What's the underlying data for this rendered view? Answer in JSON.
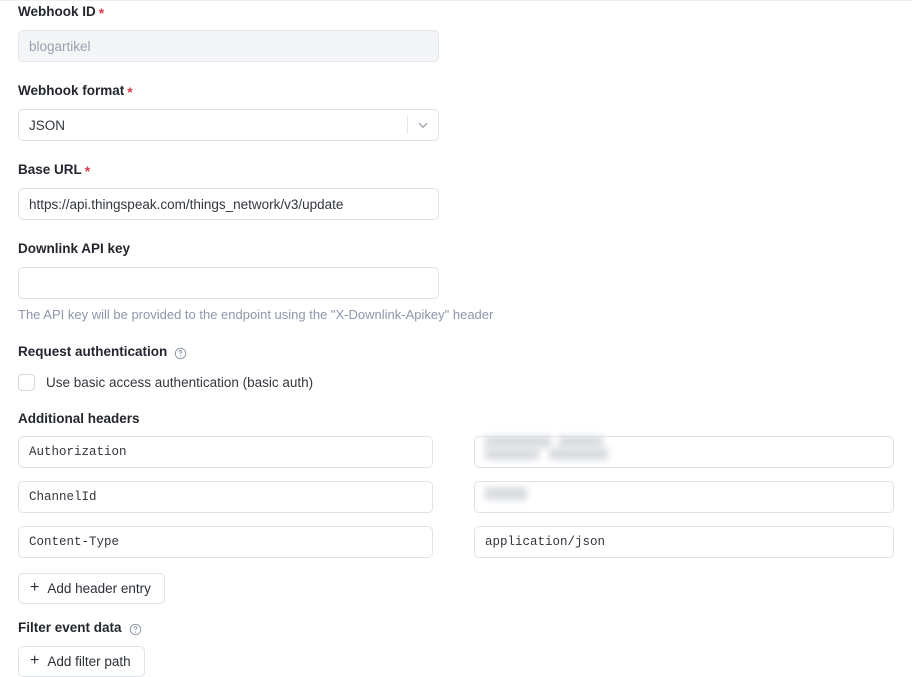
{
  "form": {
    "webhook_id": {
      "label": "Webhook ID",
      "required": true,
      "value": "blogartikel",
      "disabled": true
    },
    "webhook_format": {
      "label": "Webhook format",
      "required": true,
      "selected": "JSON",
      "options": [
        "JSON"
      ],
      "icon": "chevron-down-icon"
    },
    "base_url": {
      "label": "Base URL",
      "required": true,
      "value": "https://api.thingspeak.com/things_network/v3/update"
    },
    "downlink_api_key": {
      "label": "Downlink API key",
      "required": false,
      "value": "",
      "placeholder": "",
      "hint": "The API key will be provided to the endpoint using the \"X-Downlink-Apikey\" header"
    },
    "request_authentication": {
      "label": "Request authentication",
      "help_icon": "question-circle-icon",
      "checkbox_label": "Use basic access authentication (basic auth)",
      "checked": false
    },
    "additional_headers": {
      "label": "Additional headers",
      "rows": [
        {
          "key": "Authorization",
          "value": "",
          "redacted": true
        },
        {
          "key": "ChannelId",
          "value": "",
          "redacted": true
        },
        {
          "key": "Content-Type",
          "value": "application/json",
          "redacted": false
        }
      ],
      "add_button": "Add header entry",
      "add_icon": "plus-icon"
    },
    "filter_event_data": {
      "label": "Filter event data",
      "help_icon": "question-circle-icon",
      "add_button": "Add filter path",
      "add_icon": "plus-icon"
    }
  },
  "colors": {
    "required_star": "#d73c4b",
    "label": "#23262e",
    "hint": "#8d97ab",
    "border": "#dfe3e8",
    "disabled_bg": "#f3f5f7"
  }
}
